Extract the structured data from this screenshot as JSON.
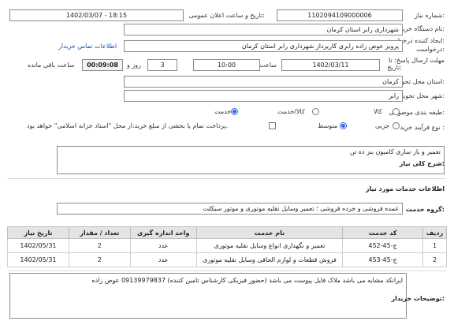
{
  "need_number": {
    "label": "شماره نیاز:",
    "value": "1102094109000006"
  },
  "announce_datetime": {
    "label": "تاریخ و ساعت اعلان عمومی:",
    "value": "1402/03/07 - 18:15"
  },
  "buyer_org": {
    "label": "نام دستگاه خریدار:",
    "value": "شهرداری رابر استان کرمان"
  },
  "requester": {
    "label": "ایجاد کننده درخواست:",
    "value": "پرویز  عوض زاده رابری کارپرداز شهرداری رابر استان کرمان",
    "contact_link": "اطلاعات تماس خریدار"
  },
  "deadline": {
    "label": "مهلت ارسال پاسخ: تا",
    "date_label": "تاریخ:",
    "date": "1402/03/11",
    "time_label": "ساعت",
    "time": "10:00",
    "days": "3",
    "days_label": "روز و",
    "remaining": "00:09:08",
    "remaining_label": "ساعت باقی مانده"
  },
  "province": {
    "label": "استان محل تحویل:",
    "value": "کرمان"
  },
  "city": {
    "label": "شهر محل تحویل:",
    "value": "رابر"
  },
  "category": {
    "label": "طبقه بندی موضوعی:",
    "options": [
      "کالا",
      "کالا/خدمت",
      "خدمت"
    ]
  },
  "purchase_type": {
    "label": "نوع فرآیند خرید :",
    "options": [
      "جزیی",
      "متوسط"
    ],
    "note": "پرداخت تمام یا بخشی از مبلغ خرید،از محل \"اسناد خزانه اسلامی\" خواهد بود."
  },
  "need_summary": {
    "label": "شرح کلی نیاز:",
    "value": "تعمیر و باز سازی کامیون بنز ده تن"
  },
  "services_title": "اطلاعات خدمات مورد نیاز",
  "service_group": {
    "label": "گروه خدمت:",
    "value": "عمده فروشی و خرده فروشی ؛ تعمیر وسایل نقلیه موتوری و موتور سیکلت"
  },
  "table": {
    "headers": [
      "ردیف",
      "کد خدمت",
      "نام خدمت",
      "واحد اندازه گیری",
      "تعداد / مقدار",
      "تاریخ نیاز"
    ],
    "rows": [
      [
        "1",
        "ج-45-452",
        "تعمیر و نگهداری انواع وسایل نقلیه موتوری",
        "عدد",
        "2",
        "1402/05/31"
      ],
      [
        "2",
        "ج-45-453",
        "فروش قطعات و لوازم الحاقی وسایل نقلیه موتوری",
        "عدد",
        "2",
        "1402/05/31"
      ]
    ]
  },
  "buyer_notes": {
    "label": "توضیحات خریدار:",
    "value": "ایرانکد مشابه می باشد ملاک فایل پیوست می باشد (حضور فیزیکی کارشناس تامین کننده)   09139979837 عوض زاده"
  }
}
